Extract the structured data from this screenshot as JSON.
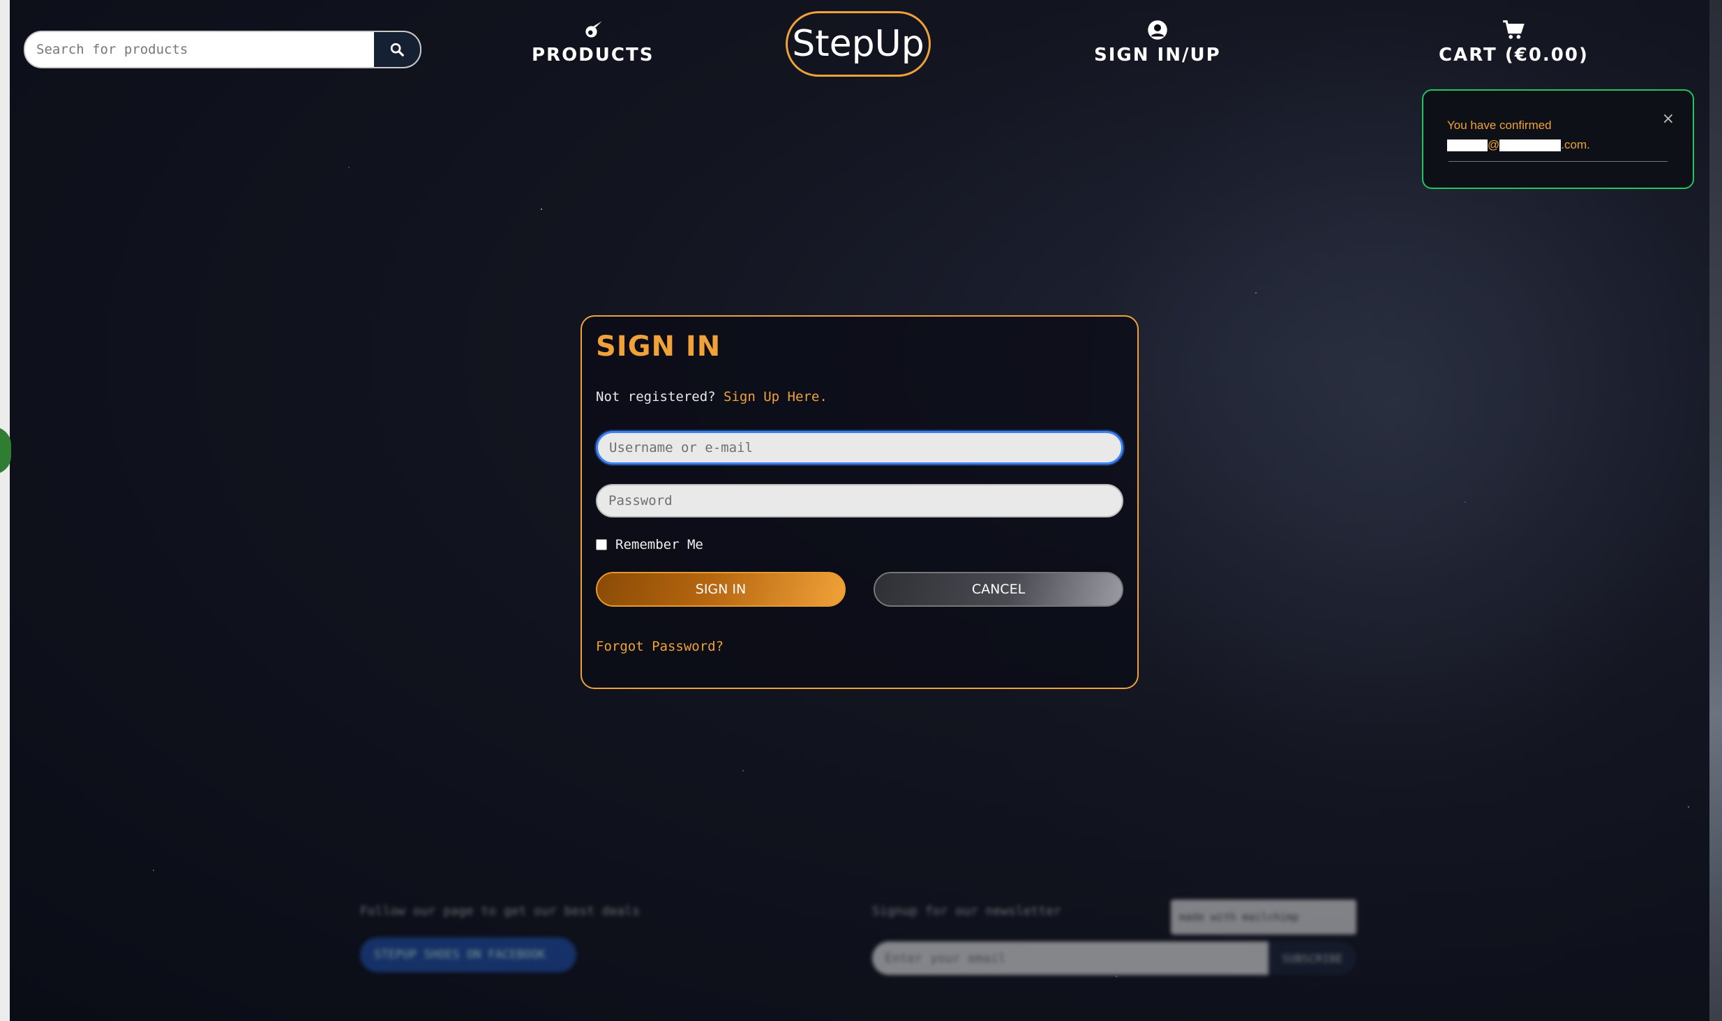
{
  "header": {
    "search": {
      "placeholder": "Search for products",
      "button_icon": "search-icon"
    },
    "nav": [
      {
        "label": "PRODUCTS",
        "icon": "meteor-icon"
      },
      {
        "label": "SIGN IN/UP",
        "icon": "user-circle-icon"
      },
      {
        "label": "CART (€0.00)",
        "icon": "cart-icon"
      }
    ],
    "logo": "StepUp"
  },
  "toast": {
    "message_prefix": "You have confirmed",
    "email_at": "@",
    "email_suffix": ".com.",
    "close_icon": "×",
    "border_color": "#22c55e"
  },
  "signin": {
    "title": "SIGN IN",
    "not_registered": "Not registered?",
    "signup_link": "Sign Up Here.",
    "username_placeholder": "Username or e-mail",
    "password_placeholder": "Password",
    "remember_label": "Remember Me",
    "signin_button": "SIGN IN",
    "cancel_button": "CANCEL",
    "forgot_link": "Forgot Password?"
  },
  "footer": {
    "fb_text": "Follow our page to get our best deals",
    "fb_button": "STEPUP SHOES ON FACEBOOK",
    "newsletter_text": "Signup for our newsletter",
    "mailchimp_badge": "made with mailchimp",
    "email_placeholder": "Enter your email",
    "subscribe_button": "SUBSCRIBE"
  },
  "colors": {
    "accent": "#f0a238",
    "background": "#0b0d18",
    "success": "#22c55e",
    "focus": "#3b82f6"
  }
}
